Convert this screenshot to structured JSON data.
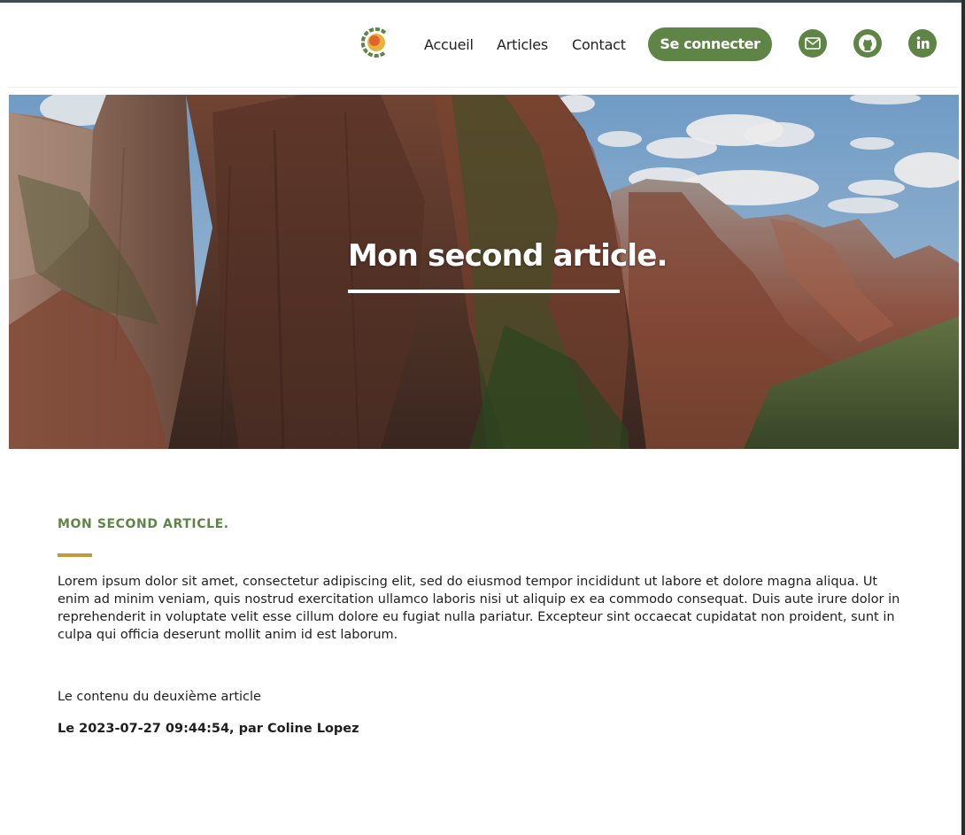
{
  "nav": {
    "logo_icon": "site-logo-icon",
    "links": [
      "Accueil",
      "Articles",
      "Contact"
    ],
    "login_label": "Se connecter",
    "social_icons": [
      "mail-icon",
      "github-icon",
      "linkedin-icon"
    ]
  },
  "hero": {
    "title": "Mon second article.",
    "image_icon": "mountain-canyon-photo"
  },
  "article": {
    "heading": "MON SECOND ARTICLE.",
    "lorem": "Lorem ipsum dolor sit amet, consectetur adipiscing elit, sed do eiusmod tempor incididunt ut labore et dolore magna aliqua. Ut enim ad minim veniam, quis nostrud exercitation ullamco laboris nisi ut aliquip ex ea commodo consequat. Duis aute irure dolor in reprehenderit in voluptate velit esse cillum dolore eu fugiat nulla pariatur. Excepteur sint occaecat cupidatat non proident, sunt in culpa qui officia deserunt mollit anim id est laborum.",
    "content": "Le contenu du deuxième article",
    "meta": "Le 2023-07-27 09:44:54, par Coline Lopez"
  },
  "colors": {
    "brand_green": "#5e8545",
    "accent_gold": "#c09a3c",
    "text": "#1e1e1e"
  }
}
